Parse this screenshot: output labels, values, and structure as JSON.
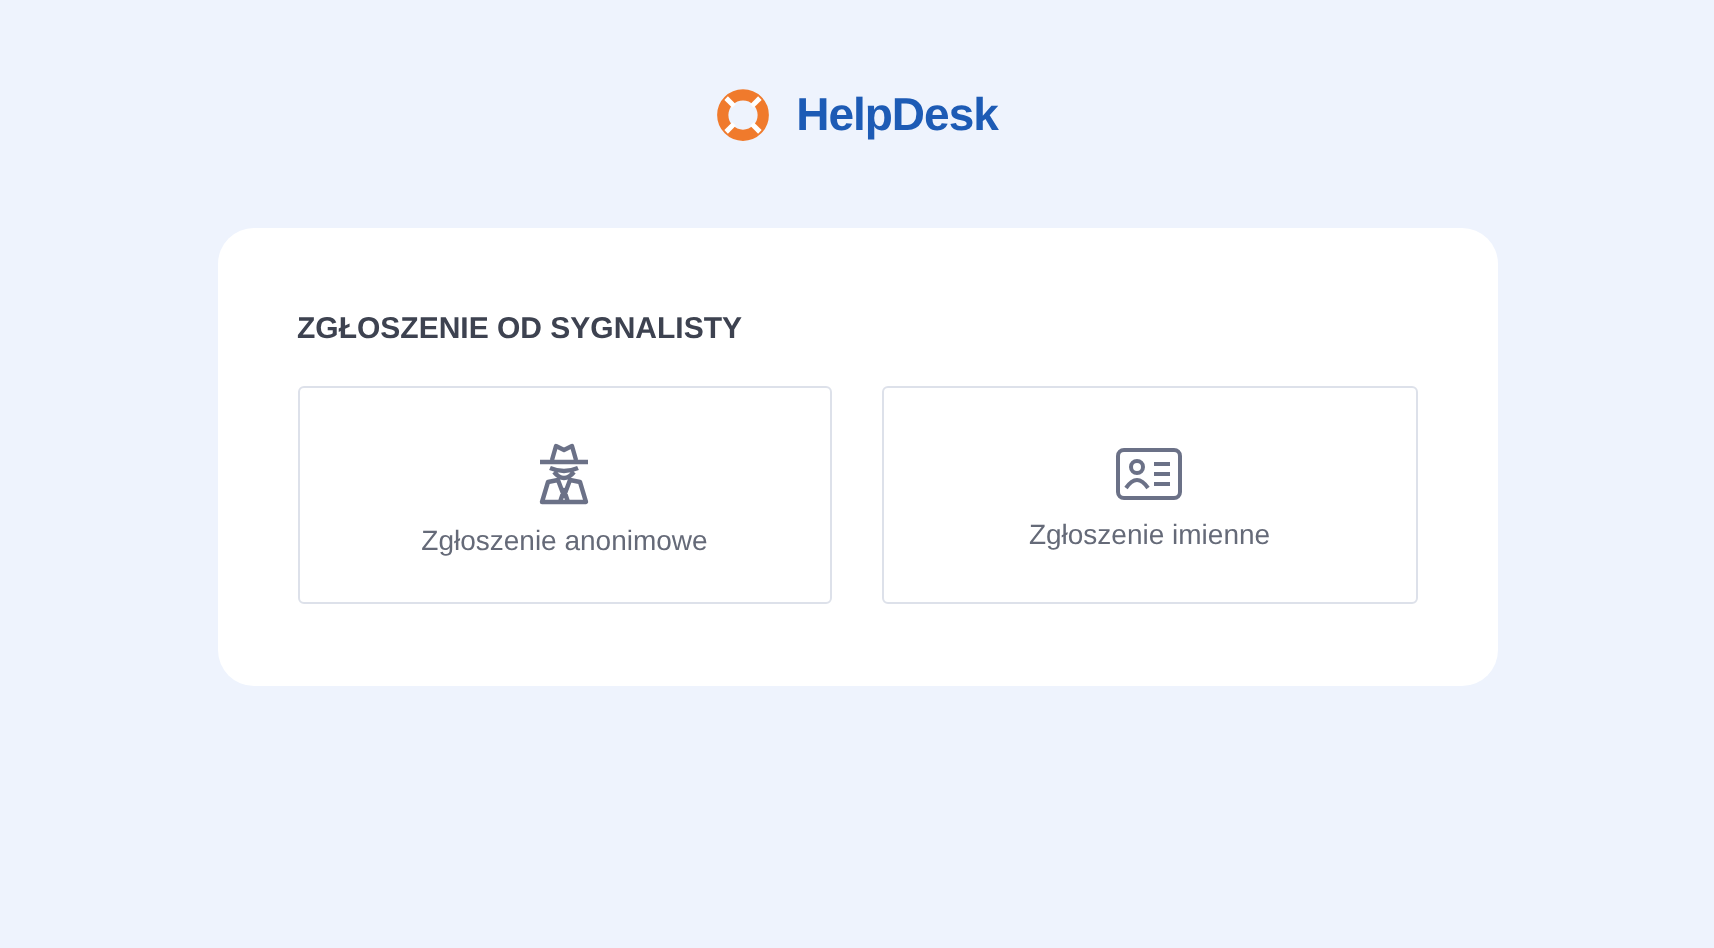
{
  "brand": {
    "name": "HelpDesk"
  },
  "panel": {
    "title": "ZGŁOSZENIE OD SYGNALISTY",
    "options": [
      {
        "kind": "anonymous",
        "label": "Zgłoszenie anonimowe"
      },
      {
        "kind": "named",
        "label": "Zgłoszenie imienne"
      }
    ]
  }
}
